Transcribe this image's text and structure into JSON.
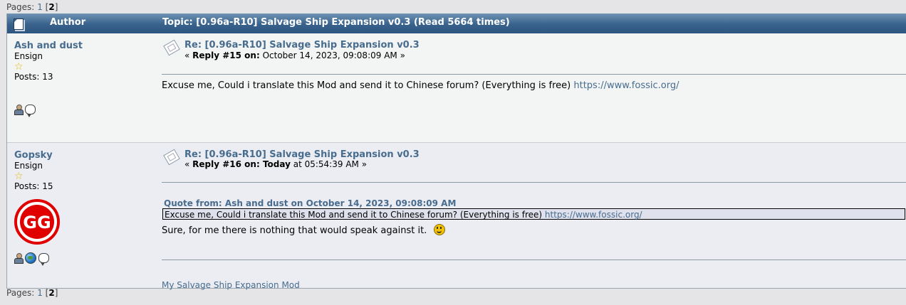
{
  "pagination": {
    "label": "Pages:",
    "page1": "1",
    "open": "[",
    "current": "2",
    "close": "]"
  },
  "header": {
    "author_label": "Author",
    "topic": "Topic: [0.96a-R10] Salvage Ship Expansion v0.3  (Read 5664 times)"
  },
  "posts": [
    {
      "author": "Ash and dust",
      "rank": "Ensign",
      "stars": "☆",
      "posts_count": "Posts: 13",
      "title": "Re: [0.96a-R10] Salvage Ship Expansion v0.3",
      "meta_open": "« ",
      "reply_label": "Reply #15 on:",
      "date": " October 14, 2023, 09:08:09 AM »",
      "body": "Excuse me, Could i translate this Mod and send it to Chinese forum? (Everything is free) ",
      "body_link": "https://www.fossic.org/"
    },
    {
      "author": "Gopsky",
      "rank": "Ensign",
      "stars": "☆",
      "posts_count": "Posts: 15",
      "title": "Re: [0.96a-R10] Salvage Ship Expansion v0.3",
      "meta_open": "« ",
      "reply_label": "Reply #16 on:",
      "date_bold": " Today",
      "date": " at 05:54:39 AM »",
      "quote_header": "Quote from: Ash and dust on October 14, 2023, 09:08:09 AM",
      "quote_text": "Excuse me, Could i translate this Mod and send it to Chinese forum? (Everything is free) ",
      "quote_link": "https://www.fossic.org/",
      "body": "Sure, for me there is nothing that would speak against it.",
      "signature": "My Salvage Ship Expansion Mod",
      "avatar_text": "GG"
    }
  ],
  "colors": {
    "link": "#476c8e",
    "title_bar": "#38628b",
    "avatar": "#e00000"
  }
}
